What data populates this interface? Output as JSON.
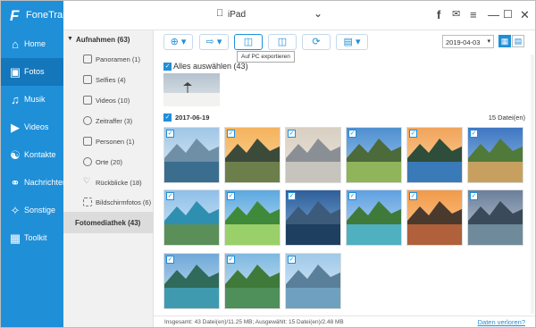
{
  "app": {
    "name": "FoneTrans"
  },
  "device": {
    "name": "iPad"
  },
  "sidebar": {
    "items": [
      {
        "label": "Home",
        "icon": "home-icon"
      },
      {
        "label": "Fotos",
        "icon": "photo-icon"
      },
      {
        "label": "Musik",
        "icon": "music-icon"
      },
      {
        "label": "Videos",
        "icon": "video-icon"
      },
      {
        "label": "Kontakte",
        "icon": "contacts-icon"
      },
      {
        "label": "Nachrichten",
        "icon": "chat-icon"
      },
      {
        "label": "Sonstige",
        "icon": "other-icon"
      },
      {
        "label": "Toolkit",
        "icon": "toolkit-icon"
      }
    ],
    "active": "Fotos"
  },
  "categories": {
    "header": "Aufnahmen (63)",
    "items": [
      {
        "label": "Panoramen (1)"
      },
      {
        "label": "Selfies (4)"
      },
      {
        "label": "Videos (10)"
      },
      {
        "label": "Zeitraffer (3)"
      },
      {
        "label": "Personen (1)"
      },
      {
        "label": "Orte (20)"
      },
      {
        "label": "Rückblicke (18)"
      },
      {
        "label": "Bildschirmfotos (6)"
      }
    ],
    "library": "Fotomediathek (43)"
  },
  "toolbar": {
    "tooltip": "Auf PC exportieren",
    "date_value": "2019-04-03"
  },
  "main": {
    "select_all": "Alles auswählen (43)",
    "group_date": "2017-06-19",
    "group_count": "15 Datei(en)"
  },
  "footer": {
    "status": "Insgesamt: 43 Datei(en)/11.25 MB; Ausgewählt: 15 Datei(en)/2.48 MB",
    "link": "Daten verloren?"
  },
  "colors": {
    "accent": "#1f8fd8",
    "accent_dark": "#1477bb"
  }
}
